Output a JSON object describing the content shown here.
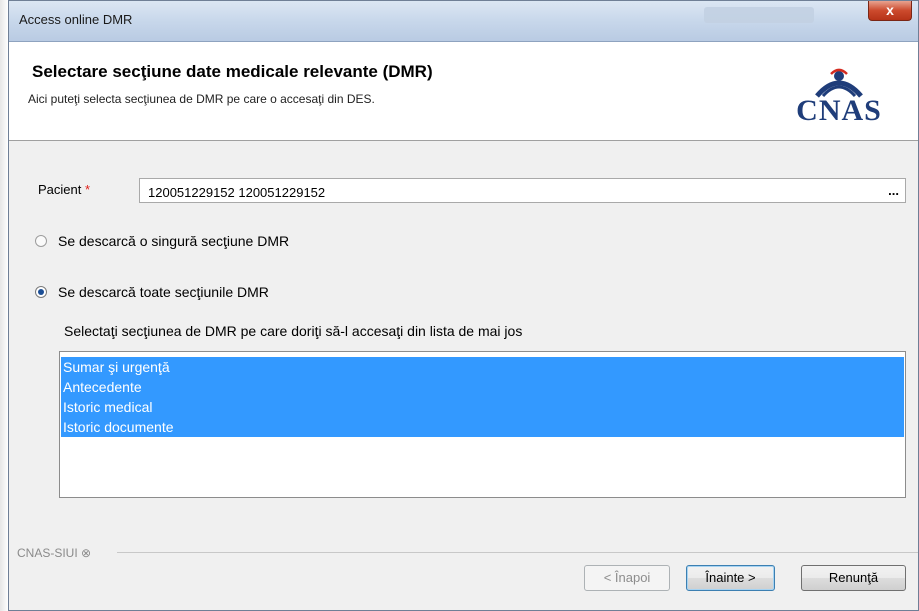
{
  "window": {
    "title": "Access online DMR",
    "close_label": "x"
  },
  "header": {
    "title": "Selectare secţiune date medicale relevante (DMR)",
    "subtitle": "Aici puteţi selecta secţiunea de DMR pe care o accesaţi din DES.",
    "logo_text": "CNAS"
  },
  "form": {
    "pacient_label": "Pacient",
    "required_mark": "*",
    "pacient_value": "120051229152 120051229152",
    "ellipsis_label": "...",
    "radio_single_label": "Se descarcă o singură secţiune DMR",
    "radio_single_checked": false,
    "radio_all_label": "Se descarcă toate secţiunile DMR",
    "radio_all_checked": true,
    "instruction": "Selectaţi secţiunea de DMR pe care doriţi să-l accesaţi din lista de mai jos",
    "sections": [
      "Sumar şi urgenţă",
      "Antecedente",
      "Istoric medical",
      "Istoric documente"
    ],
    "selection_color": "#3399ff"
  },
  "footer": {
    "label": "CNAS-SIUI ⊗",
    "back_label": "< Înapoi",
    "next_label": "Înainte >",
    "cancel_label": "Renunţă"
  }
}
